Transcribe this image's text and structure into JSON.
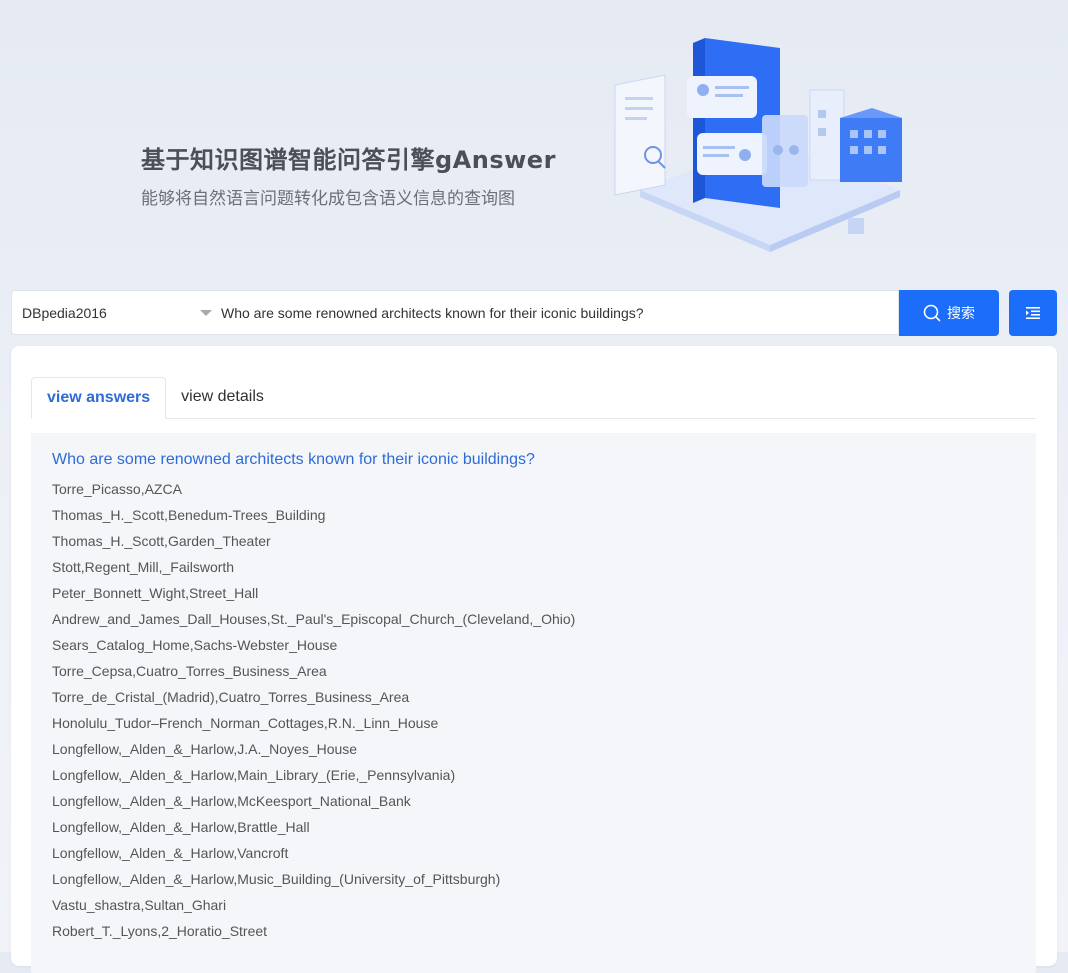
{
  "hero": {
    "title": "基于知识图谱智能问答引擎gAnswer",
    "subtitle": "能够将自然语言问题转化成包含语义信息的查询图"
  },
  "search": {
    "dataset": "DBpedia2016",
    "query": "Who are some renowned architects known for their iconic buildings?",
    "button_label": "搜索",
    "search_icon": "search-icon",
    "menu_icon": "menu-list-icon"
  },
  "tabs": [
    {
      "label": "view answers",
      "active": true
    },
    {
      "label": "view details",
      "active": false
    }
  ],
  "answers": {
    "question": "Who are some renowned architects known for their iconic buildings?",
    "items": [
      "Torre_Picasso,AZCA",
      "Thomas_H._Scott,Benedum-Trees_Building",
      "Thomas_H._Scott,Garden_Theater",
      "Stott,Regent_Mill,_Failsworth",
      "Peter_Bonnett_Wight,Street_Hall",
      "Andrew_and_James_Dall_Houses,St._Paul's_Episcopal_Church_(Cleveland,_Ohio)",
      "Sears_Catalog_Home,Sachs-Webster_House",
      "Torre_Cepsa,Cuatro_Torres_Business_Area",
      "Torre_de_Cristal_(Madrid),Cuatro_Torres_Business_Area",
      "Honolulu_Tudor–French_Norman_Cottages,R.N._Linn_House",
      "Longfellow,_Alden_&_Harlow,J.A._Noyes_House",
      "Longfellow,_Alden_&_Harlow,Main_Library_(Erie,_Pennsylvania)",
      "Longfellow,_Alden_&_Harlow,McKeesport_National_Bank",
      "Longfellow,_Alden_&_Harlow,Brattle_Hall",
      "Longfellow,_Alden_&_Harlow,Vancroft",
      "Longfellow,_Alden_&_Harlow,Music_Building_(University_of_Pittsburgh)",
      "Vastu_shastra,Sultan_Ghari",
      "Robert_T._Lyons,2_Horatio_Street"
    ]
  },
  "colors": {
    "accent": "#1b6dfa",
    "link": "#2f6bd8",
    "answer_bg": "#f4f6f9"
  }
}
